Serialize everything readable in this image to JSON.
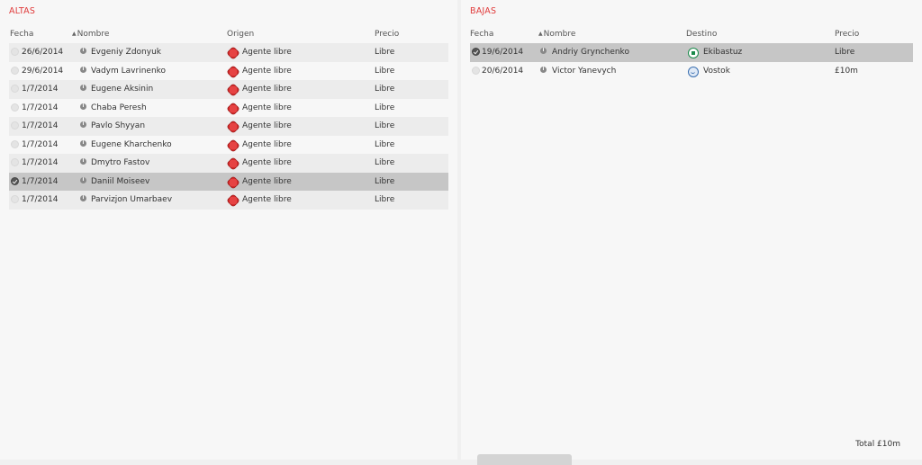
{
  "altas": {
    "title": "ALTAS",
    "headers": {
      "fecha": "Fecha",
      "nombre": "Nombre",
      "origen": "Origen",
      "precio": "Precio"
    },
    "rows": [
      {
        "fecha": "26/6/2014",
        "nombre": "Evgeniy Zdonyuk",
        "origen": "Agente libre",
        "precio": "Libre",
        "selected": false
      },
      {
        "fecha": "29/6/2014",
        "nombre": "Vadym Lavrinenko",
        "origen": "Agente libre",
        "precio": "Libre",
        "selected": false
      },
      {
        "fecha": "1/7/2014",
        "nombre": "Eugene Aksinin",
        "origen": "Agente libre",
        "precio": "Libre",
        "selected": false
      },
      {
        "fecha": "1/7/2014",
        "nombre": "Chaba Peresh",
        "origen": "Agente libre",
        "precio": "Libre",
        "selected": false
      },
      {
        "fecha": "1/7/2014",
        "nombre": "Pavlo Shyyan",
        "origen": "Agente libre",
        "precio": "Libre",
        "selected": false
      },
      {
        "fecha": "1/7/2014",
        "nombre": "Eugene Kharchenko",
        "origen": "Agente libre",
        "precio": "Libre",
        "selected": false
      },
      {
        "fecha": "1/7/2014",
        "nombre": "Dmytro Fastov",
        "origen": "Agente libre",
        "precio": "Libre",
        "selected": false
      },
      {
        "fecha": "1/7/2014",
        "nombre": "Daniil Moiseev",
        "origen": "Agente libre",
        "precio": "Libre",
        "selected": true
      },
      {
        "fecha": "1/7/2014",
        "nombre": "Parvizjon Umarbaev",
        "origen": "Agente libre",
        "precio": "Libre",
        "selected": false
      }
    ]
  },
  "bajas": {
    "title": "BAJAS",
    "headers": {
      "fecha": "Fecha",
      "nombre": "Nombre",
      "destino": "Destino",
      "precio": "Precio"
    },
    "rows": [
      {
        "fecha": "19/6/2014",
        "nombre": "Andriy Grynchenko",
        "destino": "Ekibastuz",
        "destino_icon": "green-club-badge-icon",
        "precio": "Libre",
        "selected": true
      },
      {
        "fecha": "20/6/2014",
        "nombre": "Victor Yanevych",
        "destino": "Vostok",
        "destino_icon": "blue-club-badge-icon",
        "precio": "£10m",
        "selected": false
      }
    ],
    "total": "Total £10m"
  },
  "colors": {
    "title_accent": "#e03a3a",
    "free_agent_badge": "#d42b2b"
  }
}
